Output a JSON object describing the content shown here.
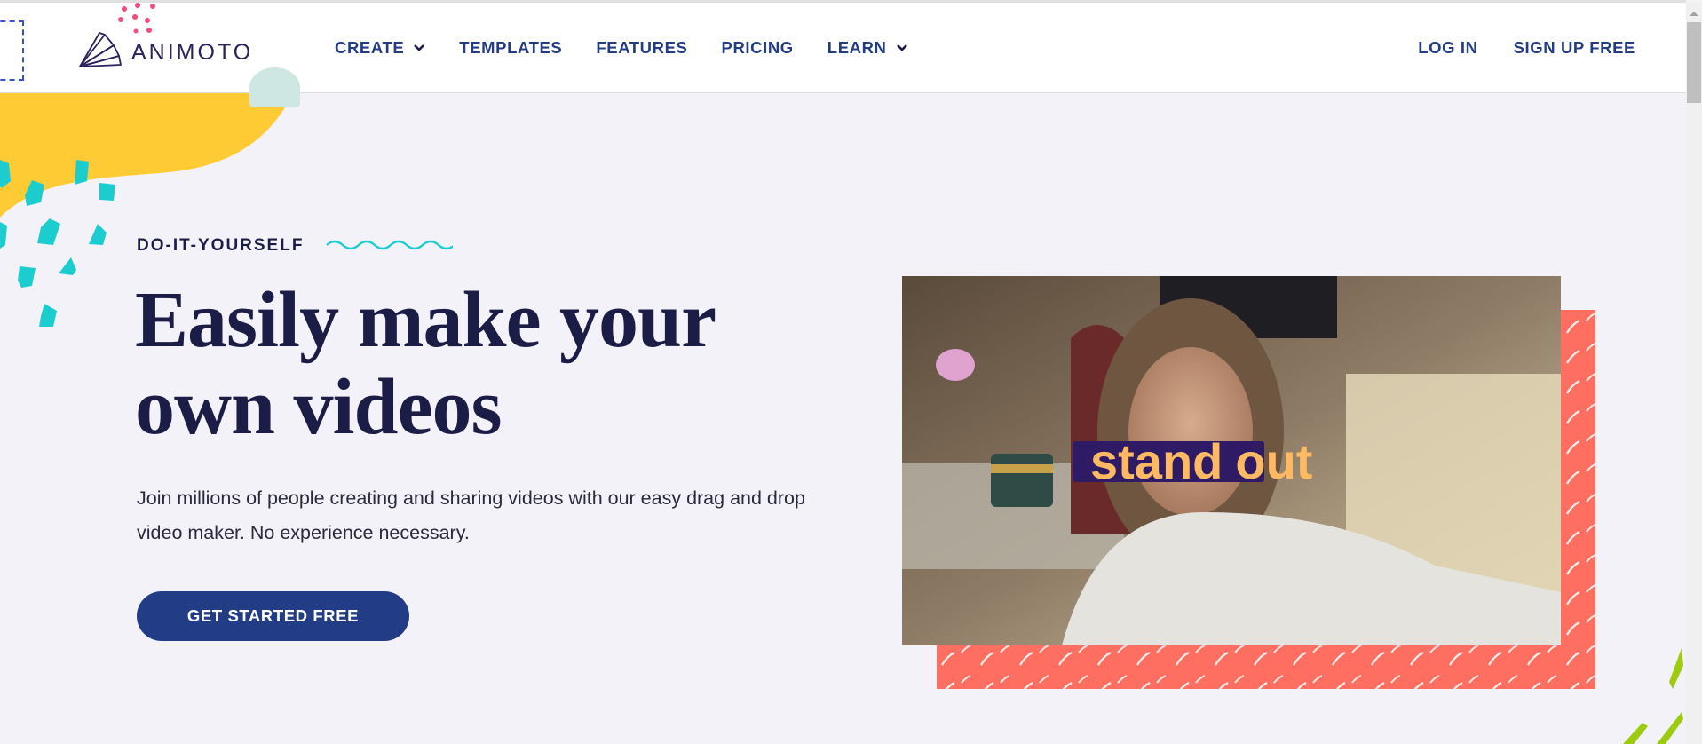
{
  "header": {
    "logo_text": "ANIMOTO",
    "nav": [
      {
        "label": "CREATE",
        "has_dropdown": true
      },
      {
        "label": "TEMPLATES",
        "has_dropdown": false
      },
      {
        "label": "FEATURES",
        "has_dropdown": false
      },
      {
        "label": "PRICING",
        "has_dropdown": false
      },
      {
        "label": "LEARN",
        "has_dropdown": true
      }
    ],
    "login_label": "LOG IN",
    "signup_label": "SIGN UP FREE"
  },
  "hero": {
    "eyebrow": "DO-IT-YOURSELF",
    "headline_line1": "Easily make your",
    "headline_line2": "own videos",
    "subtext": "Join millions of people creating and sharing videos with our easy drag and drop video maker. No experience necessary.",
    "cta_label": "GET STARTED FREE",
    "video_caption_word1": "stand",
    "video_caption_word2": "out"
  },
  "colors": {
    "brand_navy": "#233c86",
    "headline": "#1b1d47",
    "background": "#f3f2f8",
    "coral": "#ff6f61",
    "yellow": "#ffcb35",
    "teal": "#1ccdd0",
    "caption_bg": "#2f1a66",
    "caption_text": "#ffb962"
  }
}
